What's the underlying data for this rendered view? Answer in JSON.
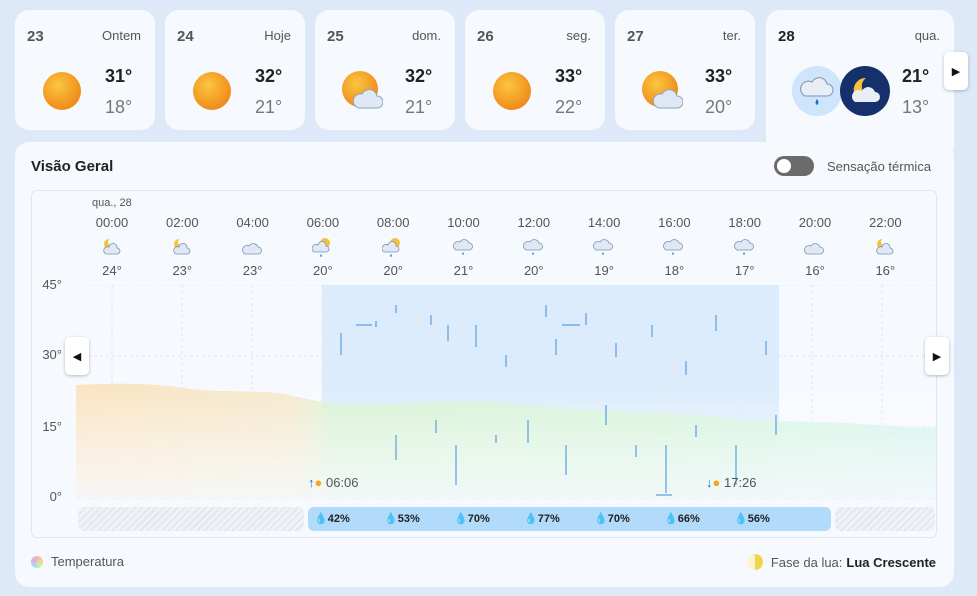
{
  "days": [
    {
      "num": "23",
      "name": "Ontem",
      "hi": "31°",
      "lo": "18°",
      "icon": "sun-icon"
    },
    {
      "num": "24",
      "name": "Hoje",
      "hi": "32°",
      "lo": "21°",
      "icon": "sun-icon"
    },
    {
      "num": "25",
      "name": "dom.",
      "hi": "32°",
      "lo": "21°",
      "icon": "sun-cloud-icon"
    },
    {
      "num": "26",
      "name": "seg.",
      "hi": "33°",
      "lo": "22°",
      "icon": "sun-icon"
    },
    {
      "num": "27",
      "name": "ter.",
      "hi": "33°",
      "lo": "20°",
      "icon": "sun-cloud-icon"
    },
    {
      "num": "28",
      "name": "qua.",
      "hi": "21°",
      "lo": "13°",
      "icon": "rain-cloud-icon",
      "icon2": "moon-cloud-icon"
    }
  ],
  "overview": {
    "title": "Visão Geral",
    "feels_like_label": "Sensação térmica",
    "feels_like_on": false,
    "date_label": "qua., 28"
  },
  "hourly": [
    {
      "time": "00:00",
      "temp": "24°",
      "icon": "moon-cloud-icon"
    },
    {
      "time": "02:00",
      "temp": "23°",
      "icon": "moon-cloud-icon"
    },
    {
      "time": "04:00",
      "temp": "23°",
      "icon": "cloud-icon"
    },
    {
      "time": "06:00",
      "temp": "20°",
      "icon": "sun-rain-icon"
    },
    {
      "time": "08:00",
      "temp": "20°",
      "icon": "sun-rain-icon"
    },
    {
      "time": "10:00",
      "temp": "21°",
      "icon": "rain-cloud-icon"
    },
    {
      "time": "12:00",
      "temp": "20°",
      "icon": "rain-cloud-icon"
    },
    {
      "time": "14:00",
      "temp": "19°",
      "icon": "rain-cloud-icon"
    },
    {
      "time": "16:00",
      "temp": "18°",
      "icon": "rain-cloud-icon"
    },
    {
      "time": "18:00",
      "temp": "17°",
      "icon": "rain-cloud-icon"
    },
    {
      "time": "20:00",
      "temp": "16°",
      "icon": "cloud-icon"
    },
    {
      "time": "22:00",
      "temp": "16°",
      "icon": "moon-cloud-icon"
    }
  ],
  "y_ticks": [
    "45°",
    "30°",
    "15°",
    "0°"
  ],
  "sunrise": "06:06",
  "sunset": "17:26",
  "humidity": [
    "42%",
    "53%",
    "70%",
    "77%",
    "70%",
    "66%",
    "56%"
  ],
  "legend": {
    "temperature": "Temperatura",
    "moon_prefix": "Fase da lua:",
    "moon_phase": "Lua Crescente"
  },
  "colors": {
    "rain_band": "#d6e9fb",
    "humidity_bar": "#b2dafa",
    "toggle_off": "#6b6b6b"
  }
}
